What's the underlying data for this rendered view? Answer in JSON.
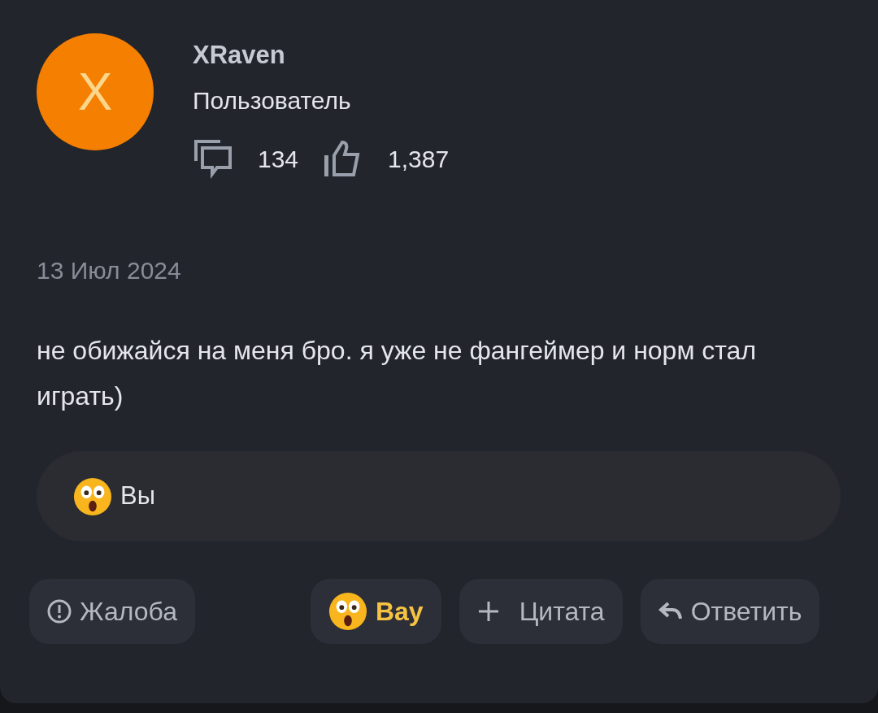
{
  "author": {
    "initial": "X",
    "name": "XRaven",
    "role": "Пользователь",
    "messages": "134",
    "likes": "1,387"
  },
  "date": "13 Июл 2024",
  "message": "не обижайся на меня бро. я уже не фангеймер и норм стал играть)",
  "reactions_summary": {
    "text": "Вы"
  },
  "actions": [
    {
      "kind": "report",
      "label": "Жалоба"
    },
    {
      "kind": "reaction",
      "label": "Вау",
      "selected": true
    },
    {
      "kind": "quote",
      "label": "Цитата"
    },
    {
      "kind": "reply",
      "label": "Ответить"
    }
  ]
}
